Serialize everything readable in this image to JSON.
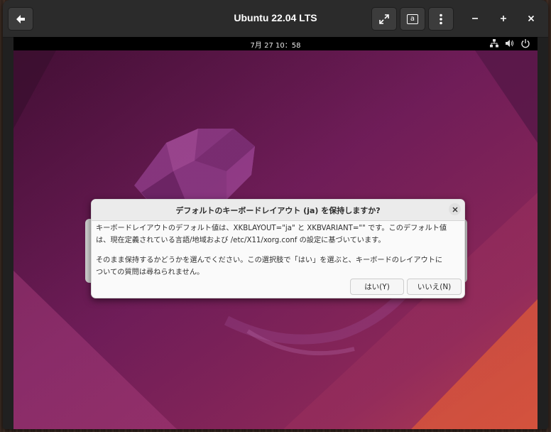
{
  "window": {
    "title": "Ubuntu 22.04 LTS",
    "back_icon": "arrow-left-icon",
    "fullscreen_icon": "expand-icon",
    "keyboard_icon": "keyboard-capture-icon",
    "keyboard_glyph": "a",
    "menu_icon": "kebab-menu-icon",
    "minimize_label": "−",
    "maximize_label": "+",
    "close_label": "×"
  },
  "guest": {
    "clock": "7月 27  10：58",
    "tray_icons": [
      "network-icon",
      "volume-icon",
      "power-icon"
    ]
  },
  "dialog": {
    "title": "デフォルトのキーボードレイアウト (ja) を保持しますか?",
    "close_label": "×",
    "paragraph1_line1": "キーボードレイアウトのデフォルト値は、XKBLAYOUT=\"ja\" と XKBVARIANT=\"\" です。このデフォルト値",
    "paragraph1_line2": "は、現在定義されている言語/地域および /etc/X11/xorg.conf の設定に基づいています。",
    "paragraph2_line1": "そのまま保持するかどうかを選んでください。この選択肢で「はい」を選ぶと、キーボードのレイアウトに",
    "paragraph2_line2": "ついての質問は尋ねられません。",
    "yes_label": "はい(Y)",
    "no_label": "いいえ(N)"
  },
  "colors": {
    "wallpaper_dark": "#2c001e",
    "wallpaper_mid": "#77216f",
    "wallpaper_orange": "#e95420"
  }
}
